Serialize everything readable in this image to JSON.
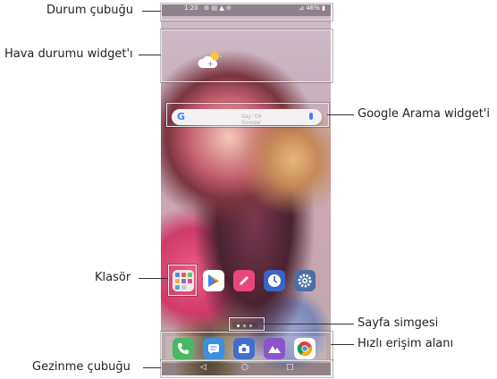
{
  "callouts": {
    "status_bar": "Durum çubuğu",
    "weather_widget": "Hava durumu widget'ı",
    "google_search_widget": "Google Arama widget'i",
    "folder": "Klasör",
    "page_icon": "Sayfa simgesi",
    "quick_access": "Hızlı erişim alanı",
    "navigation_bar": "Gezinme çubuğu"
  },
  "phone": {
    "status": {
      "time": "1:20",
      "right": "⊿ 46% ▮"
    },
    "search": {
      "logo": "G",
      "placeholder": "Say 'Ok Google'"
    }
  },
  "colors": {
    "callout_line": "#333333",
    "highlight_box": "#e8e8e8",
    "google_blue": "#4285F4"
  }
}
